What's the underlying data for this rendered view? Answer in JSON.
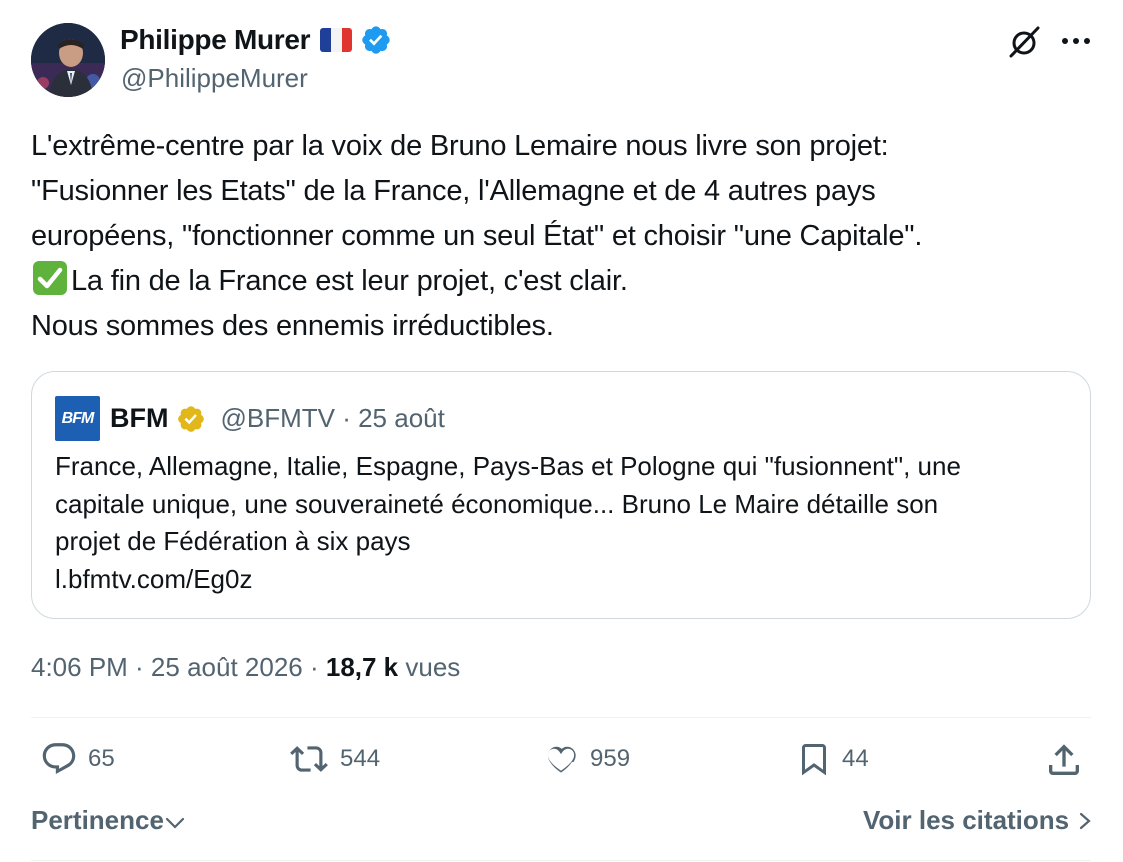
{
  "author": {
    "name": "Philippe Murer",
    "handle": "@PhilippeMurer",
    "avatar_icon": "profile-photo",
    "flag": "french-flag",
    "verified_color": "#1d9bf0"
  },
  "header_icons": {
    "grok": "grok-icon",
    "more": "more-horizontal-icon"
  },
  "tweet": {
    "lines": [
      "L'extrême-centre par la voix de Bruno Lemaire nous livre son projet:",
      "\"Fusionner les Etats\" de la France, l'Allemagne et de 4 autres pays",
      "européens, \"fonctionner comme un seul État\" et choisir \"une Capitale\".",
      "La fin de la France est leur projet, c'est clair.",
      "Nous sommes des ennemis irréductibles."
    ],
    "emoji": "check-mark-button-emoji"
  },
  "quoted": {
    "logo_text": "BFM",
    "name": "BFM",
    "verified_color": "#e2b719",
    "handle_date": "@BFMTV · 25 août",
    "lines": [
      "France, Allemagne, Italie, Espagne, Pays-Bas et Pologne qui \"fusionnent\", une",
      "capitale unique, une souveraineté économique... Bruno Le Maire détaille son",
      "projet de Fédération à six pays",
      "l.bfmtv.com/Eg0z"
    ]
  },
  "meta": {
    "time_date": "4:06 PM · 25 août 2026 · ",
    "views_count": "18,7 k",
    "views_label": " vues"
  },
  "actions": {
    "replies": "65",
    "retweets": "544",
    "likes": "959",
    "bookmarks": "44"
  },
  "footer": {
    "sort_label": "Pertinence",
    "quotes_label": "Voir les citations"
  },
  "colors": {
    "text": "#0f1419",
    "secondary": "#536471",
    "border": "#cfd9de",
    "bfm_blue": "#1d5fb3"
  }
}
